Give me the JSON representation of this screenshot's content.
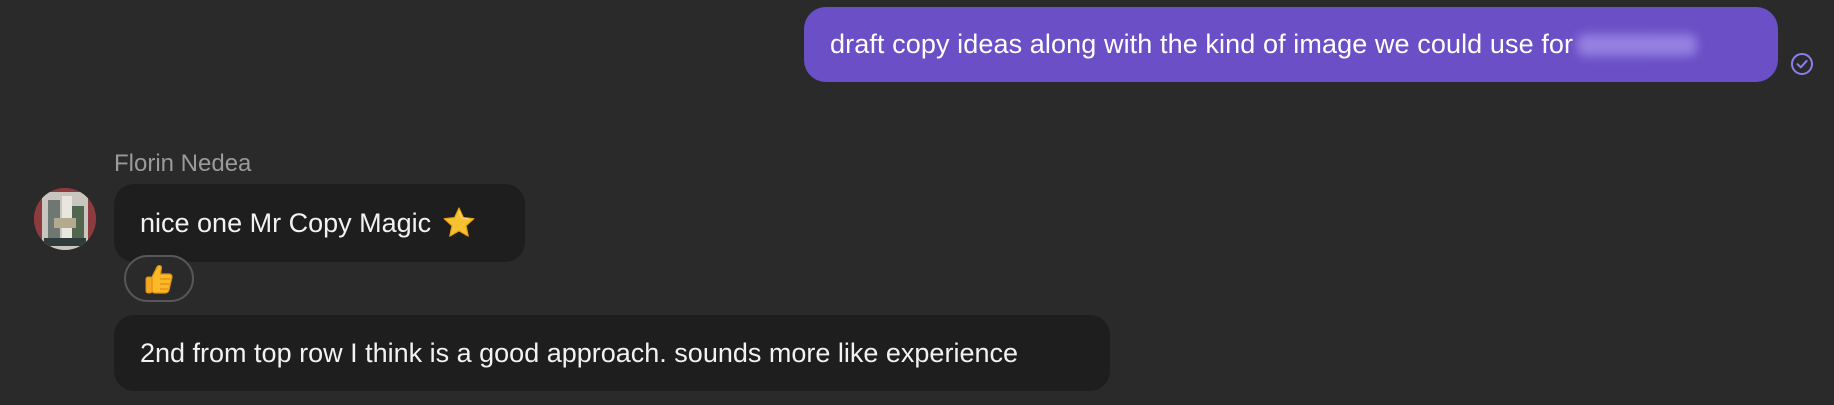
{
  "outgoing_message": {
    "text": "draft copy ideas along with the kind of image we could use for",
    "status_icon": "check-circle-icon"
  },
  "incoming": {
    "sender_name": "Florin Nedea",
    "avatar_icon": "avatar",
    "messages": [
      {
        "text": "nice one Mr Copy Magic",
        "emoji": "star-emoji-icon"
      },
      {
        "text": "2nd from top row I think is a good approach. sounds more like experience"
      }
    ],
    "reaction": {
      "emoji": "thumbs-up-emoji-icon"
    }
  },
  "colors": {
    "background": "#2a2a2b",
    "outgoing_bubble": "#6a4fc6",
    "incoming_bubble": "#1e1e1f",
    "status_icon": "#8b7ff0",
    "sender_name": "#9a9a9c"
  }
}
